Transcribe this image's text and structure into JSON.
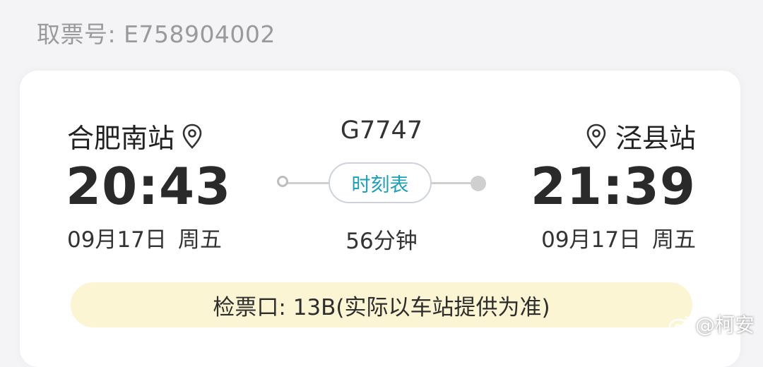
{
  "pickup": {
    "label": "取票号: E758904002"
  },
  "departure": {
    "station": "合肥南站",
    "time": "20:43",
    "date": "09月17日",
    "weekday": "周五"
  },
  "arrival": {
    "station": "泾县站",
    "time": "21:39",
    "date": "09月17日",
    "weekday": "周五"
  },
  "train": {
    "number": "G7747",
    "schedule_button": "时刻表",
    "duration": "56分钟"
  },
  "gate": {
    "text": "检票口: 13B(实际以车站提供为准)"
  },
  "watermark": {
    "text": "@柯安"
  },
  "colors": {
    "accent": "#1aa0b8",
    "gate_bg": "#fbf5d4",
    "muted": "#9a9a9a"
  },
  "icons": {
    "station_pin": "location-pin-icon",
    "watermark_logo": "weibo-icon"
  }
}
